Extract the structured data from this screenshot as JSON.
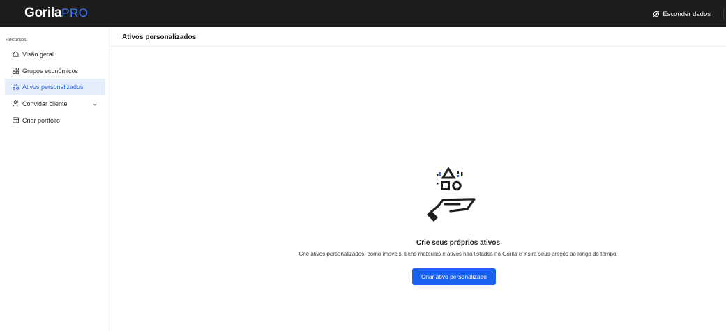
{
  "brand": {
    "name": "Gorila",
    "suffix": "PRO"
  },
  "topbar": {
    "hide_data_label": "Esconder dados",
    "hide_data_icon": "eye-off-icon"
  },
  "sidebar": {
    "section_title": "Recursos",
    "items": [
      {
        "label": "Visão geral",
        "icon": "home-icon",
        "active": false
      },
      {
        "label": "Grupos econômicos",
        "icon": "groups-icon",
        "active": false
      },
      {
        "label": "Ativos personalizados",
        "icon": "assets-icon",
        "active": true
      },
      {
        "label": "Convidar cliente",
        "icon": "invite-user-icon",
        "active": false,
        "has_chevron": true
      },
      {
        "label": "Criar portfólio",
        "icon": "portfolio-icon",
        "active": false
      }
    ]
  },
  "header": {
    "title": "Ativos personalizados"
  },
  "empty_state": {
    "illustration": "hand-with-shapes-illustration",
    "title": "Crie seus próprios ativos",
    "description": "Crie ativos personalizados, como imóveis, bens materiais e ativos não listados no Gorila e insira seus preços ao longo do tempo.",
    "cta_label": "Criar ativo personalizado"
  },
  "colors": {
    "topbar": "#1d1d1f",
    "accent": "#1a63f0",
    "active_bg": "#e6eefc",
    "brand_pro": "#3f7df6"
  }
}
